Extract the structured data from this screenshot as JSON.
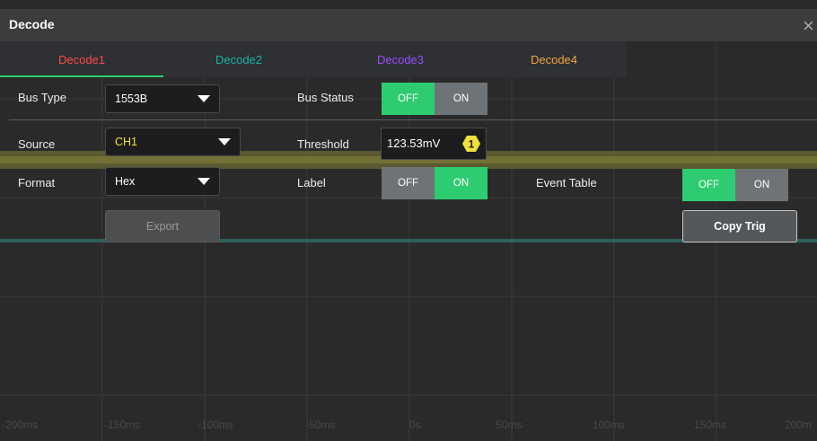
{
  "window": {
    "title": "Decode",
    "close_glyph": "×"
  },
  "tabs": [
    {
      "label": "Decode1",
      "color": "#ff4a4a",
      "active": true
    },
    {
      "label": "Decode2",
      "color": "#1ab3a6"
    },
    {
      "label": "Decode3",
      "color": "#9a4cff"
    },
    {
      "label": "Decode4",
      "color": "#f0a63b"
    }
  ],
  "bus_type": {
    "label": "Bus Type",
    "value": "1553B"
  },
  "bus_status": {
    "label": "Bus Status",
    "off": "OFF",
    "on": "ON",
    "state": "OFF"
  },
  "source": {
    "label": "Source",
    "value": "CH1",
    "value_color": "#f0e23a"
  },
  "threshold": {
    "label": "Threshold",
    "value": "123.53mV",
    "channel_badge": "1",
    "badge_color": "#f0e23a"
  },
  "format": {
    "label": "Format",
    "value": "Hex"
  },
  "label_toggle": {
    "label": "Label",
    "off": "OFF",
    "on": "ON",
    "state": "ON"
  },
  "event_table": {
    "label": "Event Table",
    "off": "OFF",
    "on": "ON",
    "state": "OFF"
  },
  "buttons": {
    "export": "Export",
    "copy_trig": "Copy Trig"
  },
  "time_axis": [
    "-200ms",
    "-150ms",
    "-100ms",
    "-50ms",
    "0s",
    "50ms",
    "100ms",
    "150ms",
    "200m"
  ],
  "colors": {
    "accent_green": "#2ecc71",
    "dim_toggle": "#6d7377",
    "ch1_yellow": "#f0e23a",
    "ch2_teal": "#1ab3a6"
  }
}
